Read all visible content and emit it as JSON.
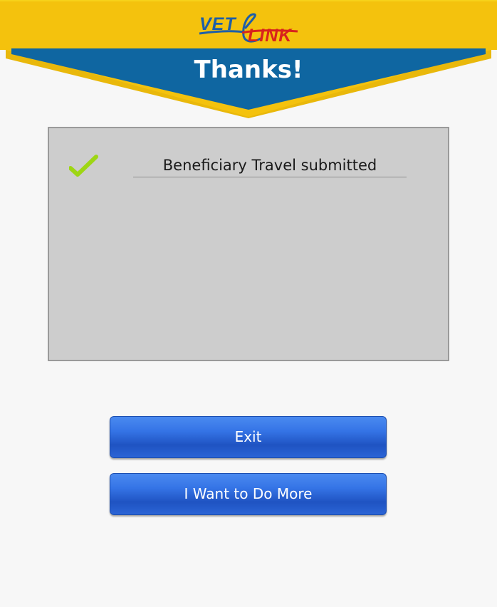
{
  "header": {
    "logo_part1": "VET",
    "logo_part2": "LINK",
    "title": "Thanks!"
  },
  "status": {
    "icon": "check-icon",
    "message": "Beneficiary Travel submitted"
  },
  "actions": {
    "exit_label": "Exit",
    "more_label": "I Want to Do More"
  },
  "colors": {
    "header_yellow": "#f4c20d",
    "banner_blue": "#0f66a1",
    "button_blue": "#2b64d6",
    "check_green": "#9ed614",
    "logo_red": "#d8231d",
    "logo_blue": "#1d5ea8"
  }
}
